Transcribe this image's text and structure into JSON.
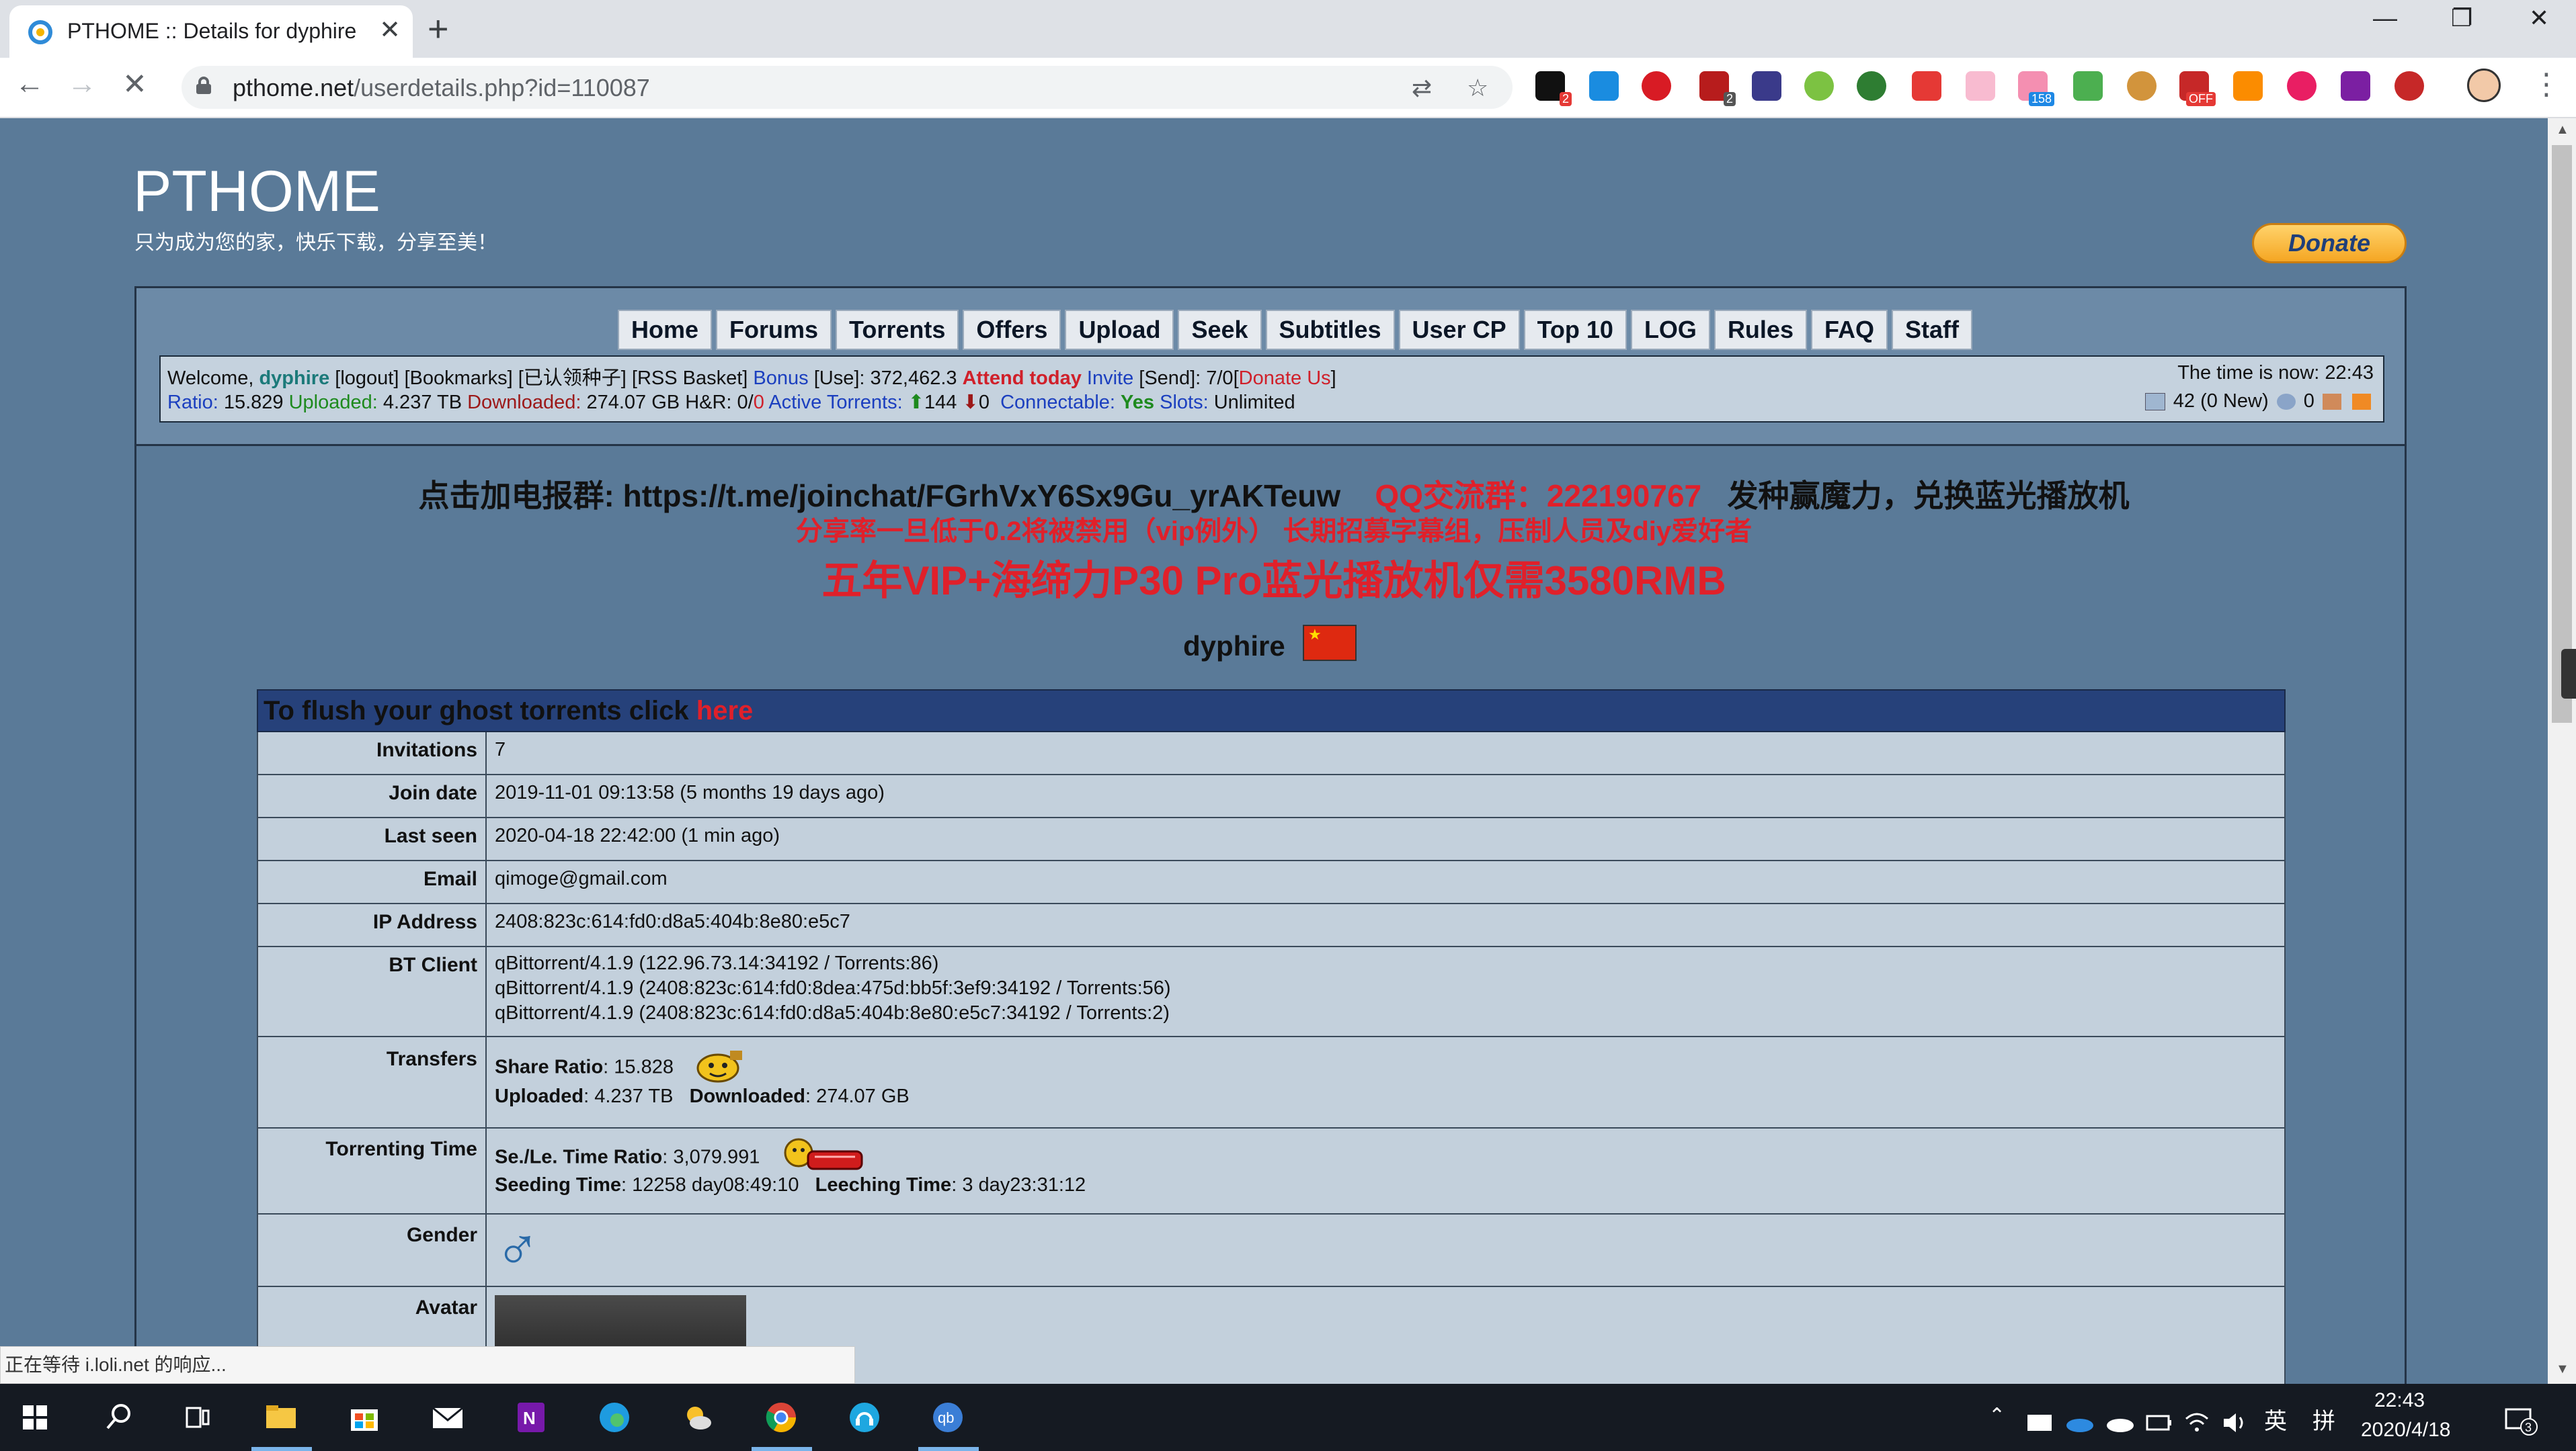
{
  "browser": {
    "tab_title": "PTHOME :: Details for dyphire",
    "url_host": "pthome.net",
    "url_path": "/userdetails.php?id=110087",
    "ext_badges": [
      "2",
      "2",
      "158",
      "OFF"
    ]
  },
  "site": {
    "title": "PTHOME",
    "slogan": "只为成为您的家，快乐下载，分享至美！",
    "donate_label": "Donate"
  },
  "nav": [
    "Home",
    "Forums",
    "Torrents",
    "Offers",
    "Upload",
    "Seek",
    "Subtitles",
    "User CP",
    "Top 10",
    "LOG",
    "Rules",
    "FAQ",
    "Staff"
  ],
  "infobar": {
    "welcome": "Welcome,",
    "username": "dyphire",
    "logout": "[logout]",
    "bookmarks": "[Bookmarks]",
    "claimed": "[已认领种子]",
    "rss": "[RSS Basket]",
    "bonus_label": "Bonus",
    "bonus_use": "[Use]:",
    "bonus_value": "372,462.3",
    "attend": "Attend today",
    "invite": "Invite",
    "send": "[Send]: 7/0",
    "donate_open": "[",
    "donate_us": "Donate Us",
    "donate_close": "]",
    "ratio_label": "Ratio:",
    "ratio": "15.829",
    "uploaded_label": "Uploaded:",
    "uploaded": "4.237 TB",
    "downloaded_label": "Downloaded:",
    "downloaded": "274.07 GB",
    "hr_label": "H&R:",
    "hr_value": "0/",
    "hr_red": "0",
    "active_label": "Active Torrents:",
    "active_up": "144",
    "active_down": "0",
    "connectable_label": "Connectable:",
    "connectable": "Yes",
    "slots_label": "Slots:",
    "slots": "Unlimited",
    "time_label": "The time is now:",
    "time": "22:43",
    "messages": "42 (0 New)",
    "friends": "0"
  },
  "announcements": {
    "telegram": "点击加电报群: https://t.me/joinchat/FGrhVxY6Sx9Gu_yrAKTeuw",
    "qq": "QQ交流群：222190767",
    "seed_reward": "发种赢魔力，兑换蓝光播放机",
    "line2": "分享率一旦低于0.2将被禁用（vip例外） 长期招募字幕组，压制人员及diy爱好者",
    "line3": "五年VIP+海缔力P30 Pro蓝光播放机仅需3580RMB"
  },
  "profile": {
    "username": "dyphire",
    "ghost_text": "To flush your ghost torrents click ",
    "ghost_link": "here",
    "rows": {
      "invitations_label": "Invitations",
      "invitations": "7",
      "join_label": "Join date",
      "join": "2019-11-01 09:13:58 (5 months 19 days ago)",
      "lastseen_label": "Last seen",
      "lastseen": "2020-04-18 22:42:00 (1 min ago)",
      "email_label": "Email",
      "email": "qimoge@gmail.com",
      "ip_label": "IP Address",
      "ip": "2408:823c:614:fd0:d8a5:404b:8e80:e5c7",
      "bt_label": "BT Client",
      "bt1": "qBittorrent/4.1.9 (122.96.73.14:34192 / Torrents:86)",
      "bt2": "qBittorrent/4.1.9 (2408:823c:614:fd0:8dea:475d:bb5f:3ef9:34192 / Torrents:56)",
      "bt3": "qBittorrent/4.1.9 (2408:823c:614:fd0:d8a5:404b:8e80:e5c7:34192 / Torrents:2)",
      "transfers_label": "Transfers",
      "share_ratio_label": "Share Ratio",
      "share_ratio": "15.828",
      "t_uploaded_label": "Uploaded",
      "t_uploaded": "4.237 TB",
      "t_downloaded_label": "Downloaded",
      "t_downloaded": "274.07 GB",
      "torrenting_label": "Torrenting Time",
      "se_le_label": "Se./Le. Time Ratio",
      "se_le": "3,079.991",
      "seeding_label": "Seeding Time",
      "seeding": "12258 day08:49:10",
      "leeching_label": "Leeching Time",
      "leeching": "3 day23:31:12",
      "gender_label": "Gender",
      "gender_symbol": "♂",
      "avatar_label": "Avatar"
    }
  },
  "status_text": "正在等待 i.loli.net 的响应...",
  "taskbar": {
    "ime": "英",
    "ime2": "拼",
    "time": "22:43",
    "date": "2020/4/18",
    "notif": "3",
    "qb_label": "qb"
  },
  "colors": {
    "page_bg": "#5a7a98",
    "accent_red": "#e0202a",
    "header_bar": "#26417a",
    "row_bg": "#c3d0dc"
  }
}
